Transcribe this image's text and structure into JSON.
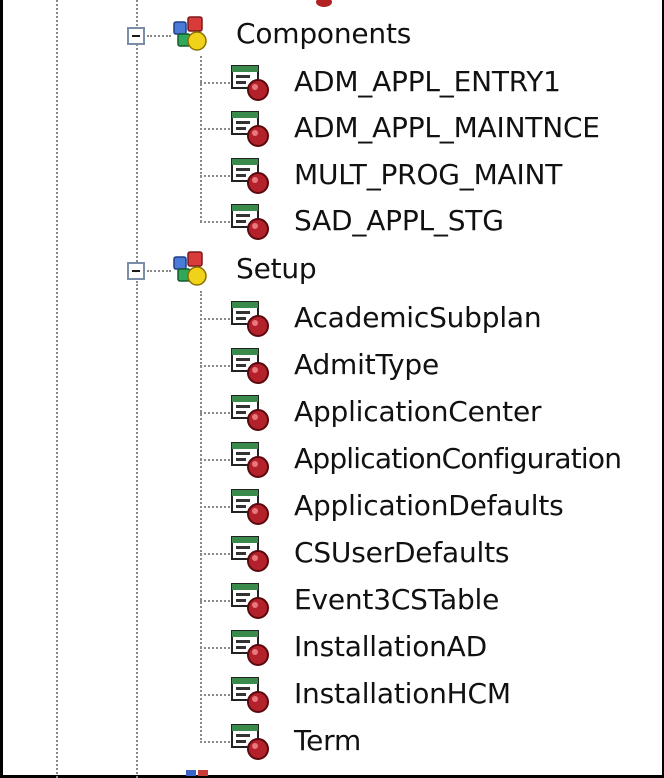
{
  "tree": {
    "folders": [
      {
        "label": "Components",
        "icon": "component-folder-icon",
        "expanded": true,
        "children": [
          {
            "label": "ADM_APPL_ENTRY1",
            "icon": "component-icon"
          },
          {
            "label": "ADM_APPL_MAINTNCE",
            "icon": "component-icon"
          },
          {
            "label": "MULT_PROG_MAINT",
            "icon": "component-icon"
          },
          {
            "label": "SAD_APPL_STG",
            "icon": "component-icon"
          }
        ]
      },
      {
        "label": "Setup",
        "icon": "component-folder-icon",
        "expanded": true,
        "children": [
          {
            "label": "AcademicSubplan",
            "icon": "component-icon"
          },
          {
            "label": "AdmitType",
            "icon": "component-icon"
          },
          {
            "label": "ApplicationCenter",
            "icon": "component-icon"
          },
          {
            "label": "ApplicationConfiguration",
            "icon": "component-icon"
          },
          {
            "label": "ApplicationDefaults",
            "icon": "component-icon"
          },
          {
            "label": "CSUserDefaults",
            "icon": "component-icon"
          },
          {
            "label": "Event3CSTable",
            "icon": "component-icon"
          },
          {
            "label": "InstallationAD",
            "icon": "component-icon"
          },
          {
            "label": "InstallationHCM",
            "icon": "component-icon"
          },
          {
            "label": "Term",
            "icon": "component-icon"
          }
        ]
      }
    ]
  },
  "colors": {
    "background": "#ffffff",
    "text": "#111111",
    "connector": "#8a8a8a",
    "expander_border": "#7a8ea8"
  }
}
